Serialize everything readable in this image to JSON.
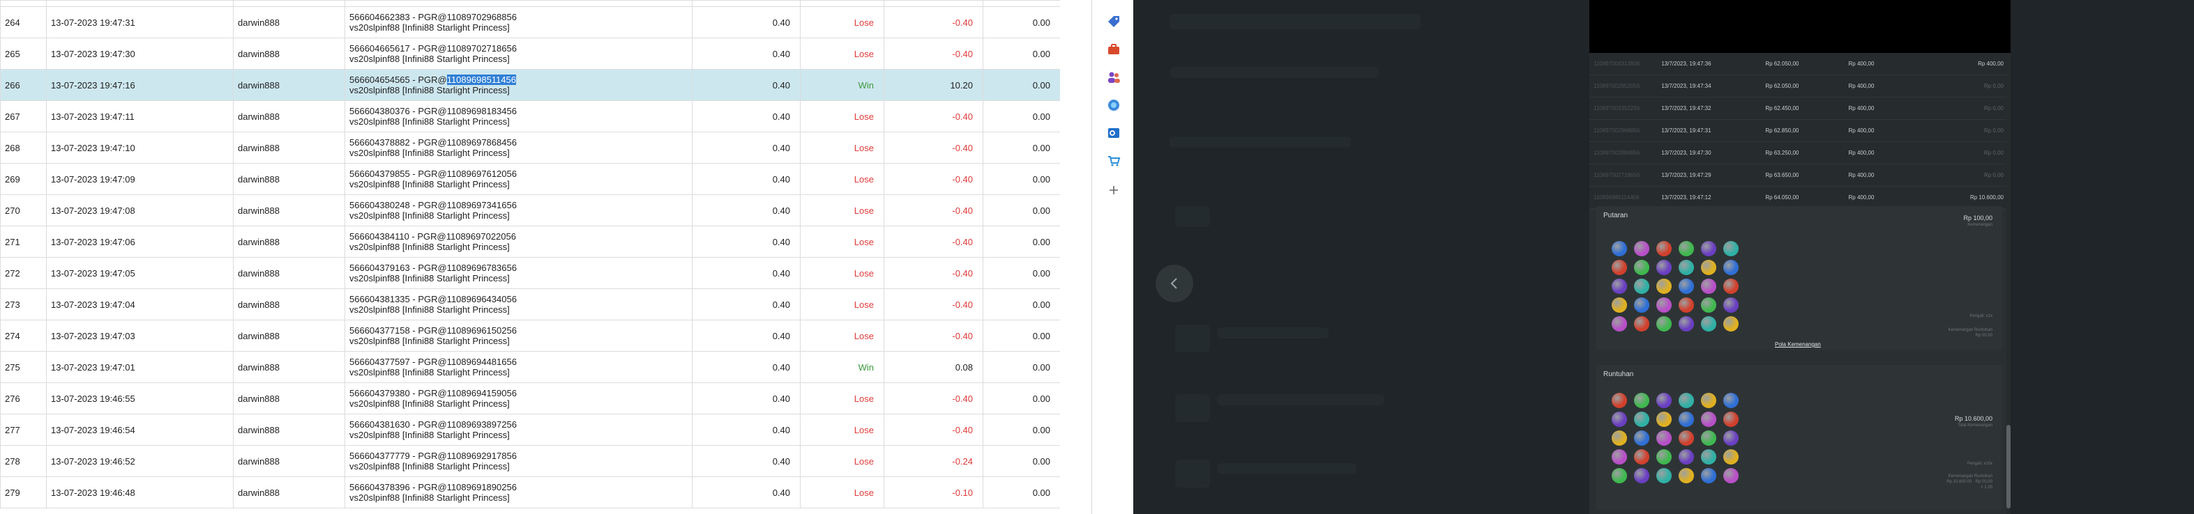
{
  "table": {
    "rows": [
      {
        "no": "264",
        "date": "13-07-2023 19:47:31",
        "user": "darwin888",
        "ref1": "566604662383 - PGR@11089702968856",
        "ref2": "vs20slpinf88 [Infini88 Starlight Princess]",
        "bet": "0.40",
        "result": "Lose",
        "winloss": "-0.40",
        "extra": "0.00"
      },
      {
        "no": "265",
        "date": "13-07-2023 19:47:30",
        "user": "darwin888",
        "ref1": "566604665617 - PGR@11089702718656",
        "ref2": "vs20slpinf88 [Infini88 Starlight Princess]",
        "bet": "0.40",
        "result": "Lose",
        "winloss": "-0.40",
        "extra": "0.00"
      },
      {
        "no": "266",
        "date": "13-07-2023 19:47:16",
        "user": "darwin888",
        "ref1a": "566604654565 - PGR@",
        "ref1b": "11089698511456",
        "ref2": "vs20slpinf88 [Infini88 Starlight Princess]",
        "bet": "0.40",
        "result": "Win",
        "winloss": "10.20",
        "extra": "0.00"
      },
      {
        "no": "267",
        "date": "13-07-2023 19:47:11",
        "user": "darwin888",
        "ref1": "566604380376 - PGR@11089698183456",
        "ref2": "vs20slpinf88 [Infini88 Starlight Princess]",
        "bet": "0.40",
        "result": "Lose",
        "winloss": "-0.40",
        "extra": "0.00"
      },
      {
        "no": "268",
        "date": "13-07-2023 19:47:10",
        "user": "darwin888",
        "ref1": "566604378882 - PGR@11089697868456",
        "ref2": "vs20slpinf88 [Infini88 Starlight Princess]",
        "bet": "0.40",
        "result": "Lose",
        "winloss": "-0.40",
        "extra": "0.00"
      },
      {
        "no": "269",
        "date": "13-07-2023 19:47:09",
        "user": "darwin888",
        "ref1": "566604379855 - PGR@11089697612056",
        "ref2": "vs20slpinf88 [Infini88 Starlight Princess]",
        "bet": "0.40",
        "result": "Lose",
        "winloss": "-0.40",
        "extra": "0.00"
      },
      {
        "no": "270",
        "date": "13-07-2023 19:47:08",
        "user": "darwin888",
        "ref1": "566604380248 - PGR@11089697341656",
        "ref2": "vs20slpinf88 [Infini88 Starlight Princess]",
        "bet": "0.40",
        "result": "Lose",
        "winloss": "-0.40",
        "extra": "0.00"
      },
      {
        "no": "271",
        "date": "13-07-2023 19:47:06",
        "user": "darwin888",
        "ref1": "566604384110 - PGR@11089697022056",
        "ref2": "vs20slpinf88 [Infini88 Starlight Princess]",
        "bet": "0.40",
        "result": "Lose",
        "winloss": "-0.40",
        "extra": "0.00"
      },
      {
        "no": "272",
        "date": "13-07-2023 19:47:05",
        "user": "darwin888",
        "ref1": "566604379163 - PGR@11089696783656",
        "ref2": "vs20slpinf88 [Infini88 Starlight Princess]",
        "bet": "0.40",
        "result": "Lose",
        "winloss": "-0.40",
        "extra": "0.00"
      },
      {
        "no": "273",
        "date": "13-07-2023 19:47:04",
        "user": "darwin888",
        "ref1": "566604381335 - PGR@11089696434056",
        "ref2": "vs20slpinf88 [Infini88 Starlight Princess]",
        "bet": "0.40",
        "result": "Lose",
        "winloss": "-0.40",
        "extra": "0.00"
      },
      {
        "no": "274",
        "date": "13-07-2023 19:47:03",
        "user": "darwin888",
        "ref1": "566604377158 - PGR@11089696150256",
        "ref2": "vs20slpinf88 [Infini88 Starlight Princess]",
        "bet": "0.40",
        "result": "Lose",
        "winloss": "-0.40",
        "extra": "0.00"
      },
      {
        "no": "275",
        "date": "13-07-2023 19:47:01",
        "user": "darwin888",
        "ref1": "566604377597 - PGR@11089694481656",
        "ref2": "vs20slpinf88 [Infini88 Starlight Princess]",
        "bet": "0.40",
        "result": "Win",
        "winloss": "0.08",
        "extra": "0.00"
      },
      {
        "no": "276",
        "date": "13-07-2023 19:46:55",
        "user": "darwin888",
        "ref1": "566604379380 - PGR@11089694159056",
        "ref2": "vs20slpinf88 [Infini88 Starlight Princess]",
        "bet": "0.40",
        "result": "Lose",
        "winloss": "-0.40",
        "extra": "0.00"
      },
      {
        "no": "277",
        "date": "13-07-2023 19:46:54",
        "user": "darwin888",
        "ref1": "566604381630 - PGR@11089693897256",
        "ref2": "vs20slpinf88 [Infini88 Starlight Princess]",
        "bet": "0.40",
        "result": "Lose",
        "winloss": "-0.40",
        "extra": "0.00"
      },
      {
        "no": "278",
        "date": "13-07-2023 19:46:52",
        "user": "darwin888",
        "ref1": "566604377779 - PGR@11089692917856",
        "ref2": "vs20slpinf88 [Infini88 Starlight Princess]",
        "bet": "0.40",
        "result": "Lose",
        "winloss": "-0.24",
        "extra": "0.00"
      },
      {
        "no": "279",
        "date": "13-07-2023 19:46:48",
        "user": "darwin888",
        "ref1": "566604378396 - PGR@11089691890256",
        "ref2": "vs20slpinf88 [Infini88 Starlight Princess]",
        "bet": "0.40",
        "result": "Lose",
        "winloss": "-0.10",
        "extra": "0.00"
      }
    ]
  },
  "side_rail": {
    "icons": [
      "tag-icon",
      "toolbox-icon",
      "people-icon",
      "copilot-icon",
      "outlook-icon",
      "cart-icon",
      "plus-icon"
    ]
  },
  "game": {
    "history": [
      {
        "id": "110897004313808",
        "date": "13/7/2023, 19:47:36",
        "balance": "Rp 62.050,00",
        "bet": "Rp 400,00",
        "win": "Rp 400,00"
      },
      {
        "id": "110897002952056",
        "date": "13/7/2023, 19:47:34",
        "balance": "Rp 62.050,00",
        "bet": "Rp 400,00",
        "win": "Rp 0,00"
      },
      {
        "id": "110897003352256",
        "date": "13/7/2023, 19:47:32",
        "balance": "Rp 62.450,00",
        "bet": "Rp 400,00",
        "win": "Rp 0,00"
      },
      {
        "id": "110897002968856",
        "date": "13/7/2023, 19:47:31",
        "balance": "Rp 62.850,00",
        "bet": "Rp 400,00",
        "win": "Rp 0,00"
      },
      {
        "id": "110897002884856",
        "date": "13/7/2023, 19:47:30",
        "balance": "Rp 63.250,00",
        "bet": "Rp 400,00",
        "win": "Rp 0,00"
      },
      {
        "id": "110897002718656",
        "date": "13/7/2023, 19:47:29",
        "balance": "Rp 63.650,00",
        "bet": "Rp 400,00",
        "win": "Rp 0,00"
      },
      {
        "id": "110896985114456",
        "date": "13/7/2023, 19:47:12",
        "balance": "Rp 64.050,00",
        "bet": "Rp 400,00",
        "win": "Rp 10.600,00"
      }
    ],
    "putaran": {
      "title": "Putaran",
      "amount": "Rp 100,00",
      "sub": "Kemenangan",
      "note1": "Pengali: x1x",
      "note2": "Kemenangan Runtuhan",
      "note3": "Rp 00,00",
      "link": "Pola Kemenangan"
    },
    "runtuhan": {
      "title": "Runtuhan",
      "amount": "Rp 10.600,00",
      "sub": "Total Kemenangan",
      "note1": "Pengali: x10x",
      "note2": "Kemenangan Runtuhan",
      "note3": "Rp 10.600,00 · Rp 00,00",
      "note4": "× 1,00"
    }
  },
  "colors": {
    "win": "#3c9a3c",
    "lose": "#e03a3a",
    "selected": "#cde7ef",
    "overlay": "#1f2528",
    "panel": "#2a2f31"
  }
}
